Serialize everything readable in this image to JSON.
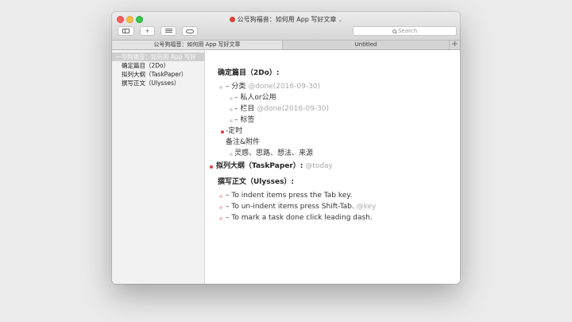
{
  "window": {
    "title": "公号狗福音：如何用 App 写好文章",
    "title_icon": "circle-red-icon",
    "title_chevron": "⌄"
  },
  "toolbar": {
    "sidebar_button_icon": "sidebar-icon",
    "add_button_label": "+",
    "list_button_icon": "list-icon",
    "pill_button_icon": "toggle-pill-icon",
    "search_placeholder": "Search"
  },
  "tabs": [
    {
      "label": "公号狗福音：如何用 App 写好文章"
    },
    {
      "label": "Untitled"
    }
  ],
  "tab_add_label": "+",
  "sidebar": {
    "items": [
      {
        "label": "一号狗福音：如何用 App 写好"
      },
      {
        "label": "确定篇目（2Do）"
      },
      {
        "label": "拟列大纲（TaskPaper）"
      },
      {
        "label": "撰写正文（Ulysses）"
      }
    ]
  },
  "editor": {
    "h1": {
      "text": "确定篇目（2Do）:"
    },
    "l1": {
      "text": "– 分类",
      "tag": "@done(2016-09-30)"
    },
    "l2": {
      "text": "– 私人or公用"
    },
    "l3": {
      "text": "– 栏目",
      "tag": "@done(2016-09-30)"
    },
    "l4": {
      "text": "– 标签"
    },
    "l5": {
      "text": "-定时"
    },
    "l6": {
      "text": "备注&附件"
    },
    "l7": {
      "text": "灵感、思路、想法、来源"
    },
    "h2": {
      "text": "拟列大纲（TaskPaper）:",
      "tag": "@today"
    },
    "h3": {
      "text": "撰写正文（Ulysses）:"
    },
    "l8": {
      "text": "– To indent items press the Tab key."
    },
    "l9": {
      "text": "– To un-indent items press Shift-Tab.",
      "tag": "@key"
    },
    "l10": {
      "text": "– To mark a task done click leading dash."
    }
  },
  "colors": {
    "accent_red": "#d9413a",
    "tag_gray": "#aaaaaa",
    "desktop_bg": "#ebebeb"
  }
}
